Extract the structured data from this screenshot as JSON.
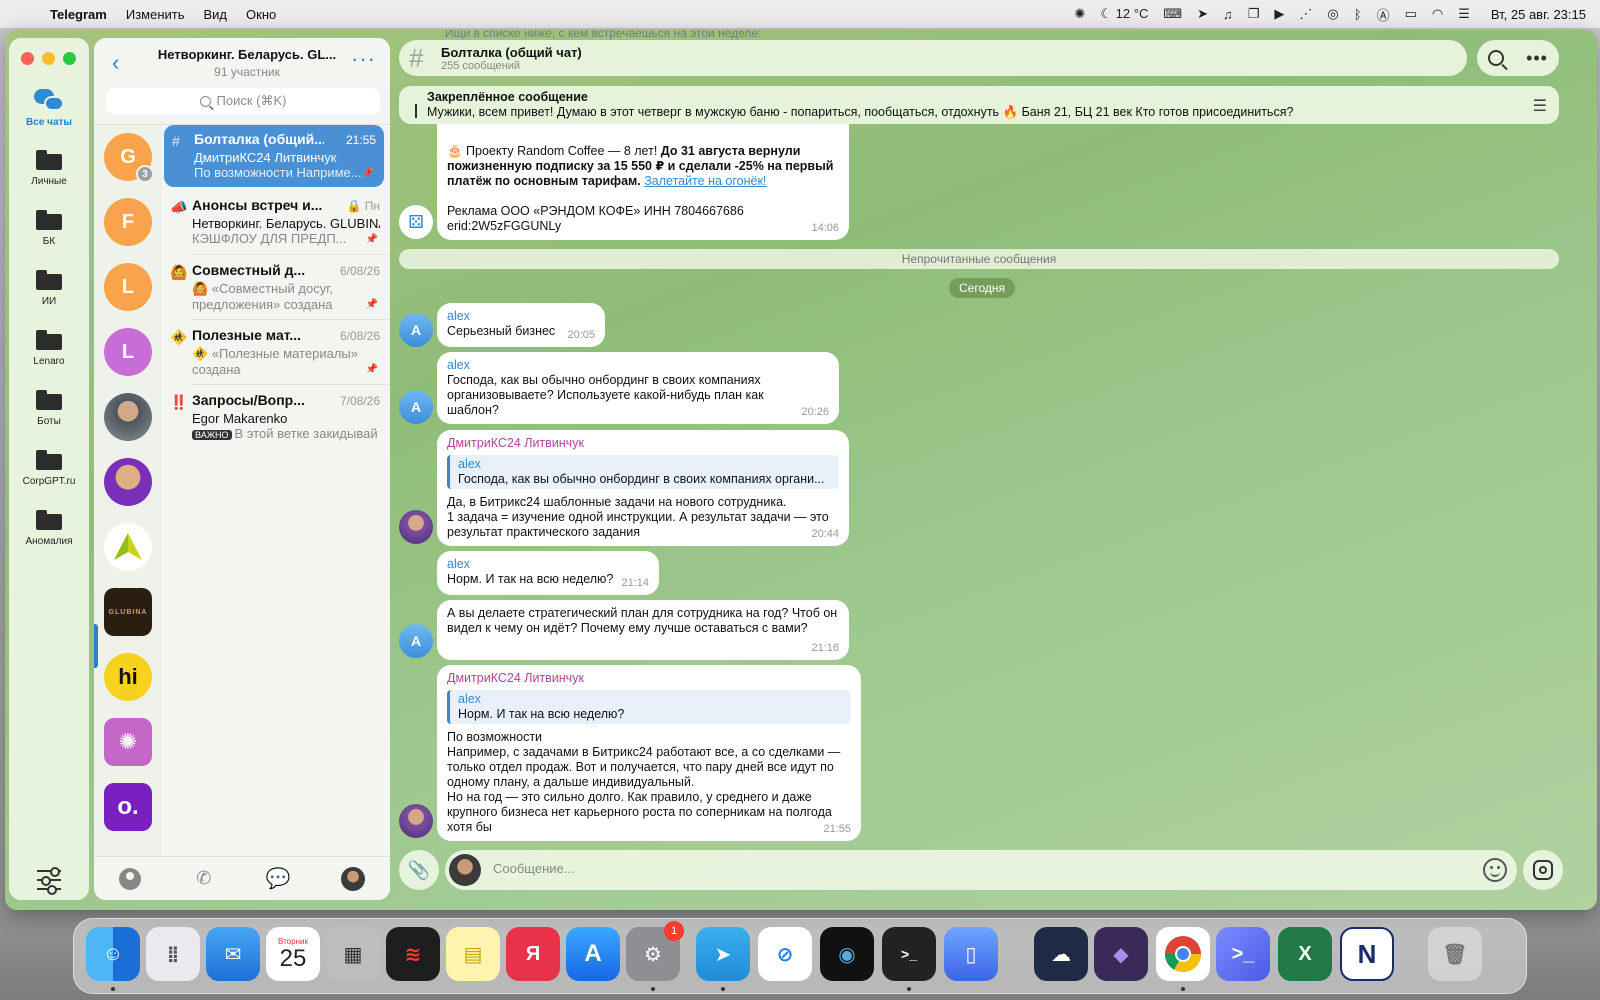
{
  "menubar": {
    "app_name": "Telegram",
    "menus": [
      "Изменить",
      "Вид",
      "Окно"
    ],
    "weather": "12 °C",
    "clock": "Вт, 25 авг.  23:15"
  },
  "folders": {
    "items": [
      {
        "label": "Все чаты",
        "icon": "chats-icon",
        "active": true
      },
      {
        "label": "Личные",
        "icon": "folder-icon"
      },
      {
        "label": "БК",
        "icon": "folder-icon"
      },
      {
        "label": "ИИ",
        "icon": "folder-icon"
      },
      {
        "label": "Lenaro",
        "icon": "folder-icon"
      },
      {
        "label": "Боты",
        "icon": "folder-icon"
      },
      {
        "label": "CorpGPT.ru",
        "icon": "folder-icon"
      },
      {
        "label": "Аномалия",
        "icon": "folder-icon"
      }
    ]
  },
  "chatlist": {
    "title": "Нетворкинг. Беларусь. GL...",
    "subtitle": "91 участник",
    "search_placeholder": "Поиск (⌘K)",
    "avatars": [
      {
        "letter": "G",
        "color": "#f7a44a",
        "badge": "3"
      },
      {
        "letter": "F",
        "color": "#f7a44a"
      },
      {
        "letter": "L",
        "color": "#f7a44a"
      },
      {
        "letter": "L",
        "color": "#c86dd7"
      },
      {
        "letter": "",
        "color": "#8a8f95"
      },
      {
        "letter": "",
        "color": "#7a2fb8"
      },
      {
        "letter": "",
        "color": "#ffffff"
      },
      {
        "letter": "",
        "color": "#2a1e12"
      },
      {
        "letter": "hi",
        "color": "#f6d21c"
      },
      {
        "letter": "",
        "color": "#c566c9"
      },
      {
        "letter": "o.",
        "color": "#7a1fc0"
      }
    ],
    "topics": [
      {
        "icon": "#",
        "name": "Болталка (общий...",
        "time": "21:55",
        "sender": "ДмитриКС24 Литвинчук",
        "preview": "По возможности Наприме...",
        "active": true
      },
      {
        "icon": "📣",
        "name": "Анонсы встреч и...",
        "time": "🔒 Пн",
        "sender": "Нетворкинг. Беларусь. GLUBINA",
        "preview": "КЭШФЛОУ ДЛЯ ПРЕДП..."
      },
      {
        "icon": "🙆",
        "name": "Совместный д...",
        "time": "6/08/26",
        "sender": "🙆 «Совместный досуг,",
        "preview": "предложения» создана"
      },
      {
        "icon": "🚸",
        "name": "Полезные мат...",
        "time": "6/08/26",
        "sender": "🚸 «Полезные материалы»",
        "preview": "создана"
      },
      {
        "icon": "‼️",
        "name": "Запросы/Вопр...",
        "time": "7/08/26",
        "sender": "Egor Makarenko",
        "badge": "ВАЖНО",
        "preview": "В этой ветке закидывай..."
      }
    ]
  },
  "chat": {
    "title": "Болталка (общий чат)",
    "subtitle": "255 сообщений",
    "pinned_title": "Закреплённое сообщение",
    "pinned_text": "Мужики, всем привет!  Думаю в этот четверг в мужскую баню - попариться, пообщаться, отдохнуть 🔥  Баня 21, БЦ 21 век  Кто готов присоединиться?",
    "top_hint": "Ищи в списке ниже, с кем встречаешься на этой неделе:",
    "ad": {
      "line1_plain": "🎂 Проекту Random Coffee — 8 лет! ",
      "line1_bold": "До 31 августа вернули",
      "line2_bold": "пожизненную подписку за 15 550 ₽ и сделали -25% на первый",
      "line3_bold": "платёж по основным тарифам. ",
      "link": "Залетайте на огонёк!",
      "legal": "Реклама ООО «РЭНДОМ КОФЕ» ИНН  7804667686",
      "erid": "erid:2W5zFGGUNLy",
      "time": "14:06"
    },
    "unread_label": "Непрочитанные сообщения",
    "date_label": "Сегодня",
    "messages": [
      {
        "sender": "alex",
        "text": "Серьезный бизнес",
        "time": "20:05"
      },
      {
        "sender": "alex",
        "text": "Господа, как вы обычно онбординг в своих компаниях организовываете? Используете какой-нибудь план как шаблон?",
        "time": "20:26"
      },
      {
        "sender": "ДмитриКС24 Литвинчук",
        "reply_name": "alex",
        "reply_text": "Господа, как вы обычно онбординг в своих компаниях органи...",
        "text": "Да, в Битрикс24 шаблонные задачи на нового сотрудника.\n1 задача = изучение одной инструкции. А результат задачи — это результат практического задания",
        "time": "20:44"
      },
      {
        "sender": "alex",
        "text": "Норм. И так на всю неделю?",
        "time": "21:14"
      },
      {
        "sender": "alex",
        "text": "А вы делаете стратегический план для сотрудника на год? Чтоб он видел к чему он идёт? Почему ему лучше оставаться с вами?",
        "time": "21:16"
      },
      {
        "sender": "ДмитриКС24 Литвинчук",
        "reply_name": "alex",
        "reply_text": "Норм. И так на всю неделю?",
        "text": "По возможности\nНапример, с задачами в Битрикс24 работают все, а со сделками — только отдел продаж. Вот и получается, что пару дней все идут по одному плану, а дальше индивидуальный.\nНо на год — это сильно долго. Как правило, у среднего и даже крупного бизнеса нет карьерного роста по соперникам на полгода хотя бы",
        "time": "21:55"
      }
    ],
    "avatar_letter": "A",
    "composer_placeholder": "Сообщение..."
  },
  "dock": {
    "calendar_month": "Вторник",
    "calendar_day": "25",
    "settings_badge": "1",
    "yandex_letter": "Я",
    "terminal_label": ">_",
    "notion_letter": "N",
    "excel_letter": "X"
  }
}
